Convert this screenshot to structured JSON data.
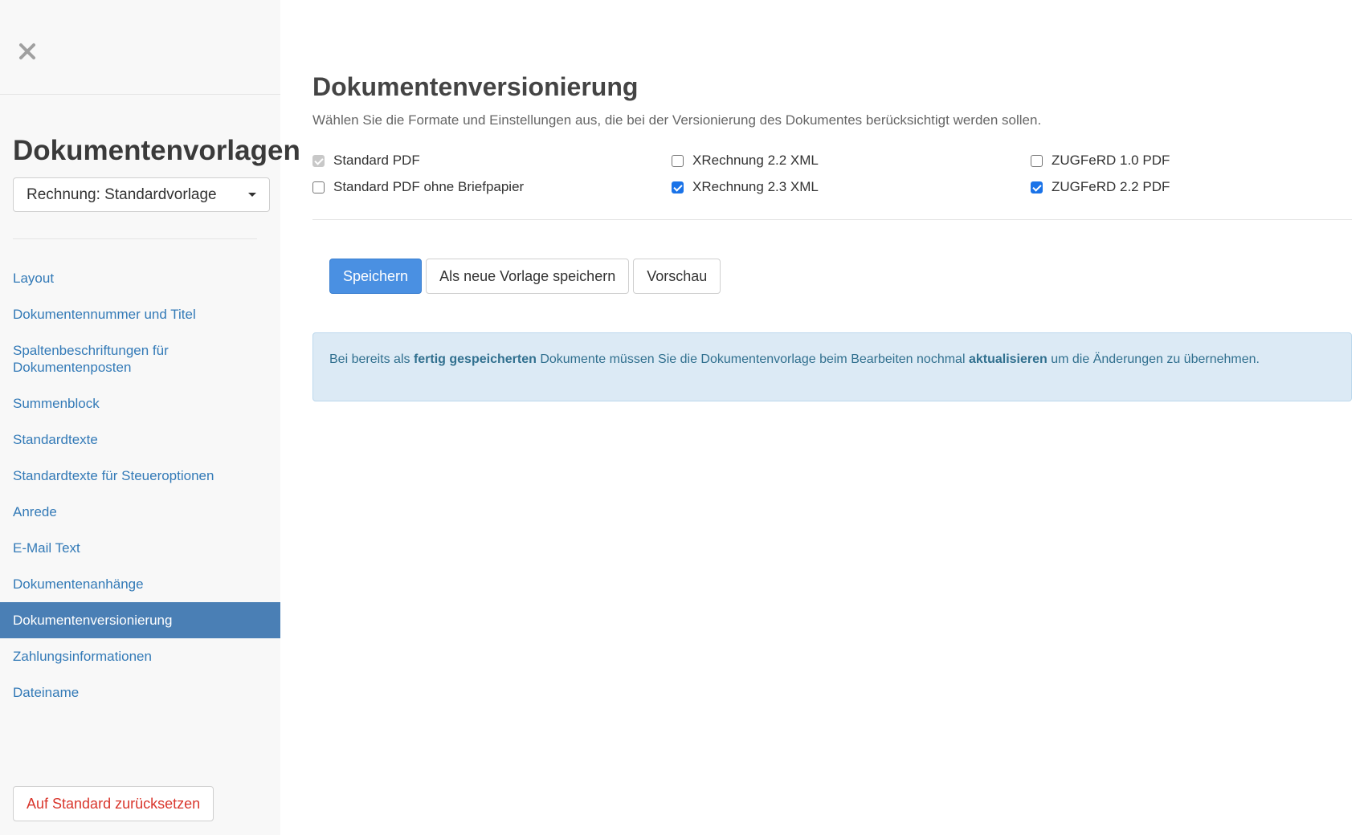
{
  "sidebar": {
    "close_icon": "close-icon",
    "title": "Dokumentenvorlagen",
    "template_select": "Rechnung: Standardvorlage",
    "items": [
      {
        "label": "Layout",
        "active": false
      },
      {
        "label": "Dokumentennummer und Titel",
        "active": false
      },
      {
        "label": "Spaltenbeschriftungen für Dokumentenposten",
        "active": false
      },
      {
        "label": "Summenblock",
        "active": false
      },
      {
        "label": "Standardtexte",
        "active": false
      },
      {
        "label": "Standardtexte für Steueroptionen",
        "active": false
      },
      {
        "label": "Anrede",
        "active": false
      },
      {
        "label": "E-Mail Text",
        "active": false
      },
      {
        "label": "Dokumentenanhänge",
        "active": false
      },
      {
        "label": "Dokumentenversionierung",
        "active": true
      },
      {
        "label": "Zahlungsinformationen",
        "active": false
      },
      {
        "label": "Dateiname",
        "active": false
      }
    ],
    "reset_label": "Auf Standard zurücksetzen"
  },
  "main": {
    "title": "Dokumentenversionierung",
    "description": "Wählen Sie die Formate und Einstellungen aus, die bei der Versionierung des Dokumentes berücksichtigt werden sollen.",
    "options": [
      {
        "label": "Standard PDF",
        "checked": true,
        "disabled": true
      },
      {
        "label": "XRechnung 2.2 XML",
        "checked": false,
        "disabled": false
      },
      {
        "label": "ZUGFeRD 1.0 PDF",
        "checked": false,
        "disabled": false
      },
      {
        "label": "Standard PDF ohne Briefpapier",
        "checked": false,
        "disabled": false
      },
      {
        "label": "XRechnung 2.3 XML",
        "checked": true,
        "disabled": false
      },
      {
        "label": "ZUGFeRD 2.2 PDF",
        "checked": true,
        "disabled": false
      }
    ],
    "buttons": {
      "save": "Speichern",
      "save_as_new": "Als neue Vorlage speichern",
      "preview": "Vorschau"
    },
    "alert": {
      "part1": "Bei bereits als ",
      "bold1": "fertig gespeicherten",
      "part2": " Dokumente müssen Sie die Dokumentenvorlage beim Bearbeiten nochmal ",
      "bold2": "aktualisieren",
      "part3": " um die Änderungen zu übernehmen."
    }
  },
  "colors": {
    "link": "#337ab7",
    "active_nav_bg": "#4a7fb5",
    "primary_button": "#4a90e2",
    "reset_text": "#d9362c",
    "alert_bg": "#dceaf5",
    "alert_text": "#31708f",
    "checkbox_checked": "#1a73e8"
  }
}
